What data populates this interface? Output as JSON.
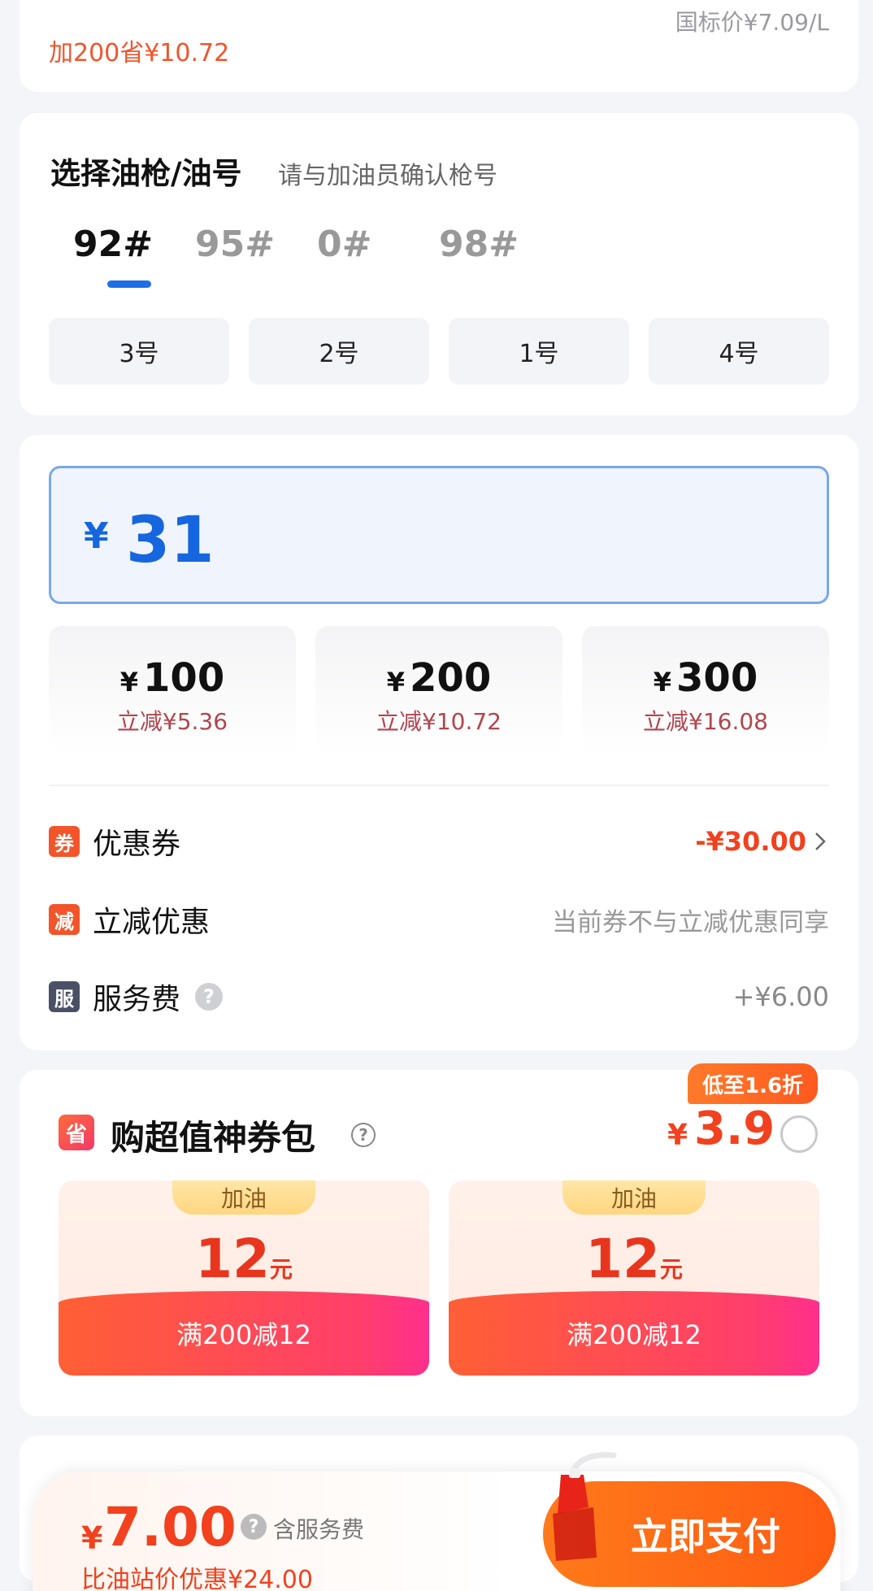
{
  "top_card": {
    "promo": "加200省¥10.72",
    "ref_price": "国标价¥7.09/L"
  },
  "gun_select": {
    "title": "选择油枪/油号",
    "subtitle": "请与加油员确认枪号",
    "fuel_types": [
      "92#",
      "95#",
      "0#",
      "98#"
    ],
    "selected_fuel": "92#",
    "guns": [
      "3号",
      "2号",
      "1号",
      "4号"
    ]
  },
  "amount": {
    "currency": "¥",
    "value": "31",
    "presets": [
      {
        "currency": "¥",
        "amount": "100",
        "discount": "立减¥5.36"
      },
      {
        "currency": "¥",
        "amount": "200",
        "discount": "立减¥10.72"
      },
      {
        "currency": "¥",
        "amount": "300",
        "discount": "立减¥16.08"
      }
    ]
  },
  "discounts": {
    "coupon": {
      "icon_text": "券",
      "label": "优惠券",
      "value": "-¥30.00"
    },
    "instant": {
      "icon_text": "减",
      "label": "立减优惠",
      "value": "当前券不与立减优惠同享"
    },
    "service": {
      "icon_text": "服",
      "label": "服务费",
      "value": "+¥6.00"
    }
  },
  "coupon_pack": {
    "icon_text": "省",
    "title": "购超值神券包",
    "badge": "低至1.6折",
    "currency": "¥",
    "price": "3.9",
    "tickets": [
      {
        "tag": "加油",
        "value": "12",
        "unit": "元",
        "condition": "满200减12"
      },
      {
        "tag": "加油",
        "value": "12",
        "unit": "元",
        "condition": "满200减12"
      }
    ]
  },
  "pay_bar": {
    "currency": "¥",
    "total": "7.00",
    "note": "含服务费",
    "saving": "比油站价优惠¥24.00",
    "button": "立即支付"
  },
  "colors": {
    "accent_blue": "#1666e0",
    "accent_orange": "#f2411e",
    "pay_button": "#ff6a16"
  }
}
